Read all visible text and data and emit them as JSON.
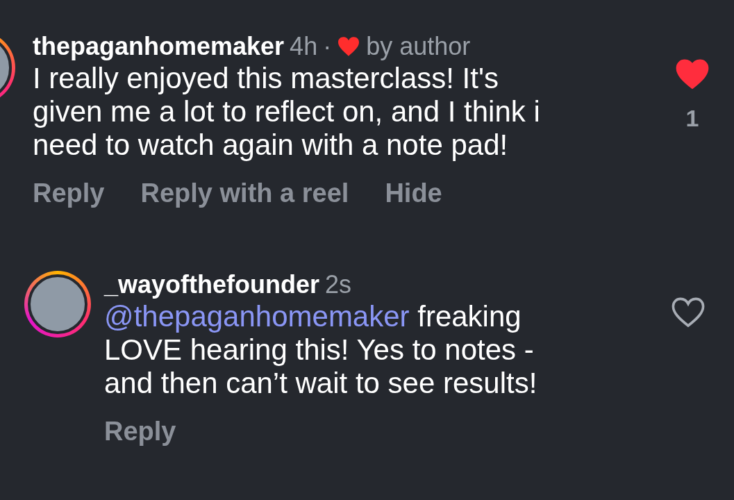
{
  "comments": [
    {
      "kind": "comment",
      "username": "thepaganhomemaker",
      "time": "4h",
      "separator": "·",
      "liked_by_author": true,
      "by_author_label": "by author",
      "text": "I really enjoyed this masterclass! It's given me a lot to reflect on, and I think i need to watch again with a note pad!",
      "actions": [
        "Reply",
        "Reply with a reel",
        "Hide"
      ],
      "liked": true,
      "like_count": "1"
    },
    {
      "kind": "reply",
      "username": "_wayofthefounder",
      "time": "2s",
      "liked_by_author": false,
      "mention": "@thepaganhomemaker",
      "text": " freaking LOVE hearing this! Yes to notes - and then can’t wait to see results!",
      "actions": [
        "Reply"
      ],
      "liked": false
    }
  ]
}
